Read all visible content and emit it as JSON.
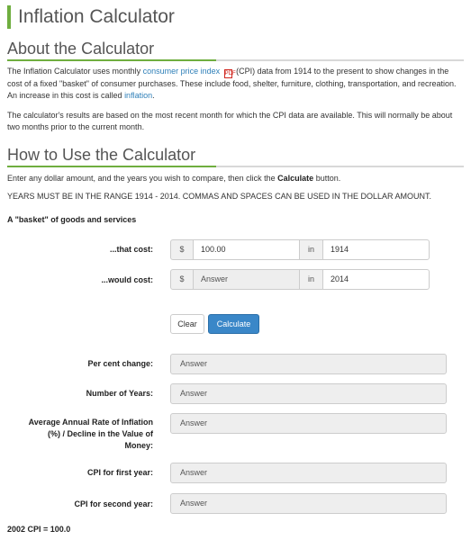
{
  "page": {
    "title": "Inflation Calculator"
  },
  "about": {
    "heading": "About the Calculator",
    "p1_a": "The Inflation Calculator uses monthly ",
    "p1_link1": "consumer price index",
    "p1_pdf_icon": "pdf-icon",
    "p1_b": " (CPI) data from 1914 to the present to show changes in the cost of a fixed \"basket\" of consumer purchases. These include food, shelter, furniture, clothing, transportation, and recreation. An increase in this cost is called ",
    "p1_link2": "inflation",
    "p1_c": ".",
    "p2": "The calculator's results are based on the most recent month for which the CPI data are available. This will normally be about two months prior to the current month."
  },
  "howto": {
    "heading": "How to Use the Calculator",
    "p1_a": "Enter any dollar amount, and the years you wish to compare, then click the ",
    "p1_bold": "Calculate",
    "p1_b": " button.",
    "p2": "YEARS MUST BE IN THE RANGE 1914 - 2014. COMMAS AND SPACES CAN BE USED IN THE DOLLAR AMOUNT."
  },
  "form": {
    "basket_label": "A \"basket\" of goods and services",
    "row1": {
      "label": "...that cost:",
      "currency": "$",
      "amount": "100.00",
      "in": "in",
      "year": "1914"
    },
    "row2": {
      "label": "...would cost:",
      "currency": "$",
      "amount": "Answer",
      "in": "in",
      "year": "2014"
    },
    "clear_label": "Clear",
    "calculate_label": "Calculate"
  },
  "results": [
    {
      "label": "Per cent change:",
      "value": "Answer"
    },
    {
      "label": "Number of Years:",
      "value": "Answer"
    },
    {
      "label": "Average Annual Rate of Inflation (%) / Decline in the Value of Money:",
      "value": "Answer"
    },
    {
      "label": "CPI for first year:",
      "value": "Answer"
    },
    {
      "label": "CPI for second year:",
      "value": "Answer"
    }
  ],
  "footer": {
    "note": "2002 CPI = 100.0"
  },
  "colors": {
    "accent": "#6fae3f",
    "link": "#2e7fb8",
    "primary_button": "#3a87c8"
  }
}
